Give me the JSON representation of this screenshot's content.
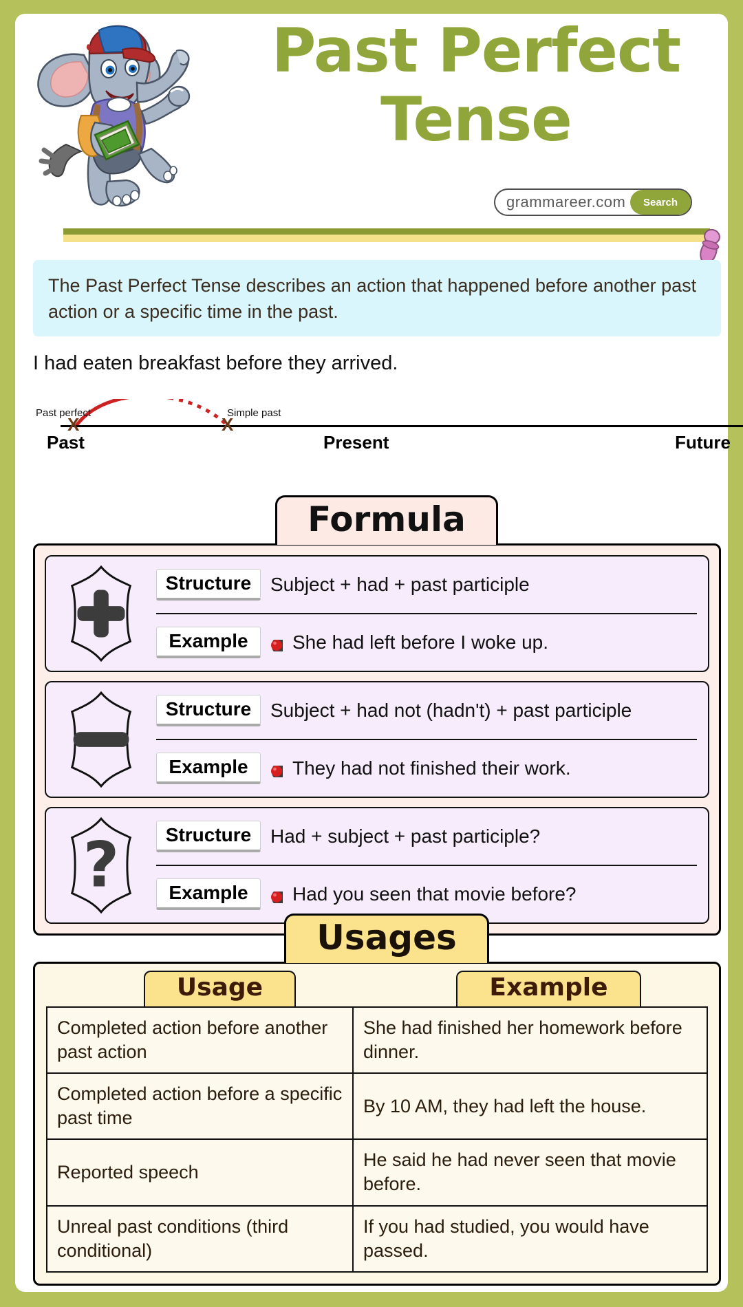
{
  "header": {
    "title": "Past Perfect Tense",
    "title_line1": "Past Perfect",
    "title_line2": "Tense",
    "mascot_icon": "elephant-student-mascot",
    "search": {
      "value": "grammareer.com",
      "button_label": "Search"
    },
    "pin_icon": "pushpin-icon"
  },
  "definition": {
    "text": "The Past Perfect Tense describes an action that happened before another past action or a specific time in the past."
  },
  "timeline": {
    "sentence": "I had eaten breakfast before they arrived.",
    "marker1_label": "Past perfect",
    "marker1_symbol": "X",
    "marker2_label": "Simple past",
    "marker2_symbol": "X",
    "axis_labels": [
      "Past",
      "Present",
      "Future"
    ],
    "arc_color": "#cc2222"
  },
  "formula": {
    "section_title": "Formula",
    "cards": [
      {
        "icon": "plus-icon",
        "structure_label": "Structure",
        "structure_text": "Subject + had + past participle",
        "example_label": "Example",
        "example_text": "She had left before I woke up."
      },
      {
        "icon": "minus-icon",
        "structure_label": "Structure",
        "structure_text": "Subject + had not (hadn't) + past participle",
        "example_label": "Example",
        "example_text": "They had not finished their work."
      },
      {
        "icon": "question-mark-icon",
        "structure_label": "Structure",
        "structure_text": "Had + subject + past participle?",
        "example_label": "Example",
        "example_text": "Had you seen that movie before?"
      }
    ]
  },
  "usages": {
    "section_title": "Usages",
    "columns": [
      "Usage",
      "Example"
    ],
    "rows": [
      {
        "usage": "Completed action before another past action",
        "example": "She had finished her homework before dinner."
      },
      {
        "usage": "Completed action before a specific past time",
        "example": "By 10 AM, they had left the house."
      },
      {
        "usage": "Reported speech",
        "example": "He said he had never seen that movie before."
      },
      {
        "usage": "Unreal past conditions (third conditional)",
        "example": "If you had studied, you would have passed."
      }
    ]
  },
  "colors": {
    "frame_green": "#b5c25b",
    "title_green": "#91a63a",
    "definition_blue": "#d9f6fd",
    "formula_bg": "#fdeee9",
    "formula_card": "#f7ecfb",
    "usages_bg": "#fdf8e6",
    "usages_tab": "#fbe38d",
    "divider_green": "#8b9a33",
    "divider_yellow": "#f4e18a"
  }
}
